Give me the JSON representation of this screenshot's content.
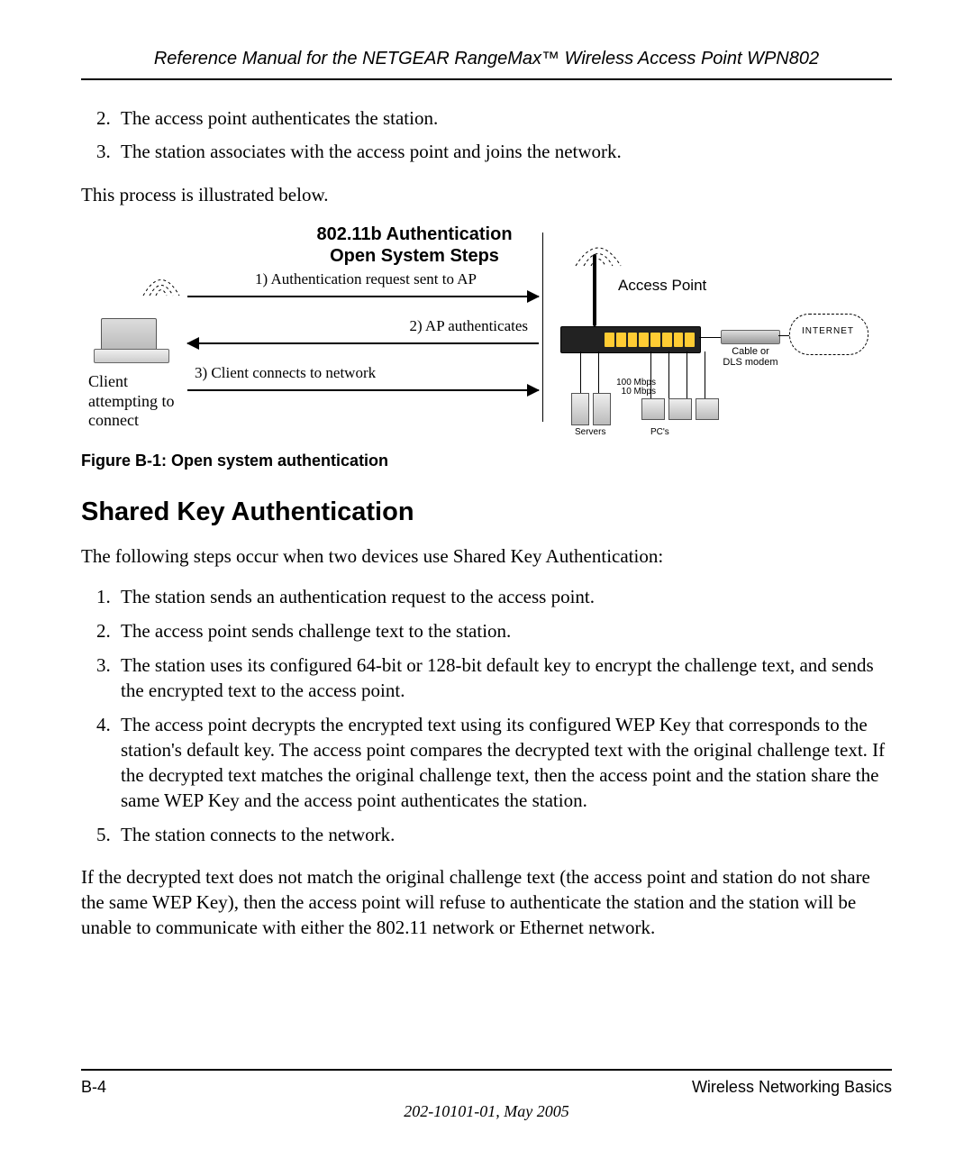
{
  "header": {
    "title": "Reference Manual for the NETGEAR RangeMax™ Wireless Access Point WPN802"
  },
  "intro_list": {
    "start": 2,
    "items": [
      "The access point authenticates the station.",
      "The station associates with the access point and joins the network."
    ]
  },
  "illustrated_text": "This process is illustrated below.",
  "figure": {
    "title_line1": "802.11b Authentication",
    "title_line2": "Open System Steps",
    "client_label": "Client attempting to connect",
    "steps": [
      "1) Authentication request sent to AP",
      "2) AP authenticates",
      "3) Client connects to network"
    ],
    "ap_label": "Access Point",
    "modem_label": "Cable or DLS modem",
    "internet_label": "INTERNET",
    "speed1": "100 Mbps",
    "speed2": "10 Mbps",
    "servers_label": "Servers",
    "pcs_label": "PC's",
    "caption": "Figure B-1:  Open system authentication"
  },
  "section_heading": "Shared Key Authentication",
  "section_intro": "The following steps occur when two devices use Shared Key Authentication:",
  "shared_steps": [
    "The station sends an authentication request to the access point.",
    "The access point sends challenge text to the station.",
    "The station uses its configured 64-bit or 128-bit default key to encrypt the challenge text, and sends the encrypted text to the access point.",
    "The access point decrypts the encrypted text using its configured WEP Key that corresponds to the station's default key. The access point compares the decrypted text with the original challenge text. If the decrypted text matches the original challenge text, then the access point and the station share the same WEP Key and the access point authenticates the station.",
    "The station connects to the network."
  ],
  "closing_para": "If the decrypted text does not match the original challenge text (the access point and station do not share the same WEP Key), then the access point will refuse to authenticate the station and the station will be unable to communicate with either the 802.11 network or Ethernet network.",
  "footer": {
    "page": "B-4",
    "section": "Wireless Networking Basics",
    "docinfo": "202-10101-01, May 2005"
  }
}
